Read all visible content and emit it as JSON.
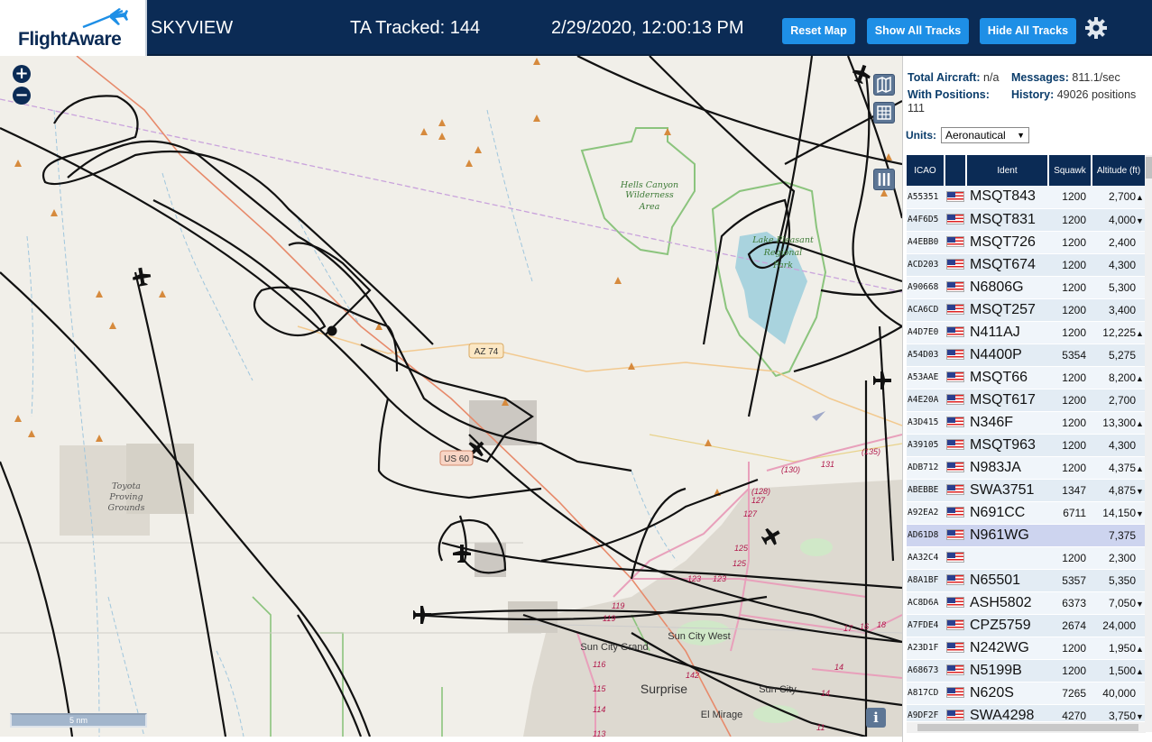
{
  "header": {
    "logo_text": "FlightAware",
    "site_name": "SKYVIEW",
    "ta_tracked": "TA Tracked: 144",
    "datetime": "2/29/2020, 12:00:13 PM",
    "buttons": {
      "reset_map": "Reset Map",
      "show_all_tracks": "Show All Tracks",
      "hide_all_tracks": "Hide All Tracks"
    },
    "settings_icon": "gear-icon",
    "accent_color": "#1e8fe6",
    "bar_color": "#0b2b55"
  },
  "map": {
    "zoom_in": "+",
    "zoom_out": "−",
    "scale_label": "5 nm",
    "info_label": "i",
    "labels": {
      "hells_canyon": [
        "Hells Canyon",
        "Wilderness",
        "Area"
      ],
      "lake_pleasant": [
        "Lake Pleasant",
        "Regional",
        "Park"
      ],
      "toyota": [
        "Toyota",
        "Proving",
        "Grounds"
      ],
      "az74": "AZ 74",
      "us60": "US 60",
      "sun_city_grand": "Sun City Grand",
      "sun_city_west": "Sun City West",
      "sun_city": "Sun City",
      "surprise": "Surprise",
      "el_mirage": "El Mirage",
      "routes": [
        "(135)",
        "131",
        "(130)",
        "(128)",
        "127",
        "127",
        "125",
        "125",
        "123",
        "123",
        "119",
        "119",
        "116",
        "115",
        "114",
        "113",
        "142",
        "17",
        "16",
        "18",
        "14",
        "14",
        "11"
      ]
    },
    "controls": [
      "map-icon",
      "grid-icon",
      "columns-icon"
    ]
  },
  "stats": {
    "total_label": "Total Aircraft:",
    "total_value": "n/a",
    "messages_label": "Messages:",
    "messages_value": "811.1/sec",
    "positions_label": "With Positions:",
    "positions_value": "111",
    "history_label": "History:",
    "history_value": "49026 positions"
  },
  "units": {
    "label": "Units:",
    "value": "Aeronautical"
  },
  "table": {
    "columns": [
      "ICAO",
      "",
      "Ident",
      "Squawk",
      "Altitude (ft)"
    ],
    "rows": [
      {
        "icao": "A55351",
        "ident": "MSQT843",
        "squawk": "1200",
        "altitude": "2,700",
        "trend": "▲"
      },
      {
        "icao": "A4F6D5",
        "ident": "MSQT831",
        "squawk": "1200",
        "altitude": "4,000",
        "trend": "▼"
      },
      {
        "icao": "A4EBB0",
        "ident": "MSQT726",
        "squawk": "1200",
        "altitude": "2,400",
        "trend": ""
      },
      {
        "icao": "ACD203",
        "ident": "MSQT674",
        "squawk": "1200",
        "altitude": "4,300",
        "trend": ""
      },
      {
        "icao": "A90668",
        "ident": "N6806G",
        "squawk": "1200",
        "altitude": "5,300",
        "trend": ""
      },
      {
        "icao": "ACA6CD",
        "ident": "MSQT257",
        "squawk": "1200",
        "altitude": "3,400",
        "trend": ""
      },
      {
        "icao": "A4D7E0",
        "ident": "N411AJ",
        "squawk": "1200",
        "altitude": "12,225",
        "trend": "▲"
      },
      {
        "icao": "A54D03",
        "ident": "N4400P",
        "squawk": "5354",
        "altitude": "5,275",
        "trend": ""
      },
      {
        "icao": "A53AAE",
        "ident": "MSQT66",
        "squawk": "1200",
        "altitude": "8,200",
        "trend": "▲"
      },
      {
        "icao": "A4E20A",
        "ident": "MSQT617",
        "squawk": "1200",
        "altitude": "2,700",
        "trend": ""
      },
      {
        "icao": "A3D415",
        "ident": "N346F",
        "squawk": "1200",
        "altitude": "13,300",
        "trend": "▲"
      },
      {
        "icao": "A39105",
        "ident": "MSQT963",
        "squawk": "1200",
        "altitude": "4,300",
        "trend": ""
      },
      {
        "icao": "ADB712",
        "ident": "N983JA",
        "squawk": "1200",
        "altitude": "4,375",
        "trend": "▲"
      },
      {
        "icao": "ABEBBE",
        "ident": "SWA3751",
        "squawk": "1347",
        "altitude": "4,875",
        "trend": "▼"
      },
      {
        "icao": "A92EA2",
        "ident": "N691CC",
        "squawk": "6711",
        "altitude": "14,150",
        "trend": "▼"
      },
      {
        "icao": "AD61D8",
        "ident": "N961WG",
        "squawk": "",
        "altitude": "7,375",
        "trend": "",
        "selected": true
      },
      {
        "icao": "AA32C4",
        "ident": "",
        "squawk": "1200",
        "altitude": "2,300",
        "trend": ""
      },
      {
        "icao": "A8A1BF",
        "ident": "N65501",
        "squawk": "5357",
        "altitude": "5,350",
        "trend": ""
      },
      {
        "icao": "AC8D6A",
        "ident": "ASH5802",
        "squawk": "6373",
        "altitude": "7,050",
        "trend": "▼"
      },
      {
        "icao": "A7FDE4",
        "ident": "CPZ5759",
        "squawk": "2674",
        "altitude": "24,000",
        "trend": ""
      },
      {
        "icao": "A23D1F",
        "ident": "N242WG",
        "squawk": "1200",
        "altitude": "1,950",
        "trend": "▲"
      },
      {
        "icao": "A68673",
        "ident": "N5199B",
        "squawk": "1200",
        "altitude": "1,500",
        "trend": "▲"
      },
      {
        "icao": "A817CD",
        "ident": "N620S",
        "squawk": "7265",
        "altitude": "40,000",
        "trend": ""
      },
      {
        "icao": "A9DF2F",
        "ident": "SWA4298",
        "squawk": "4270",
        "altitude": "3,750",
        "trend": "▼"
      }
    ]
  }
}
